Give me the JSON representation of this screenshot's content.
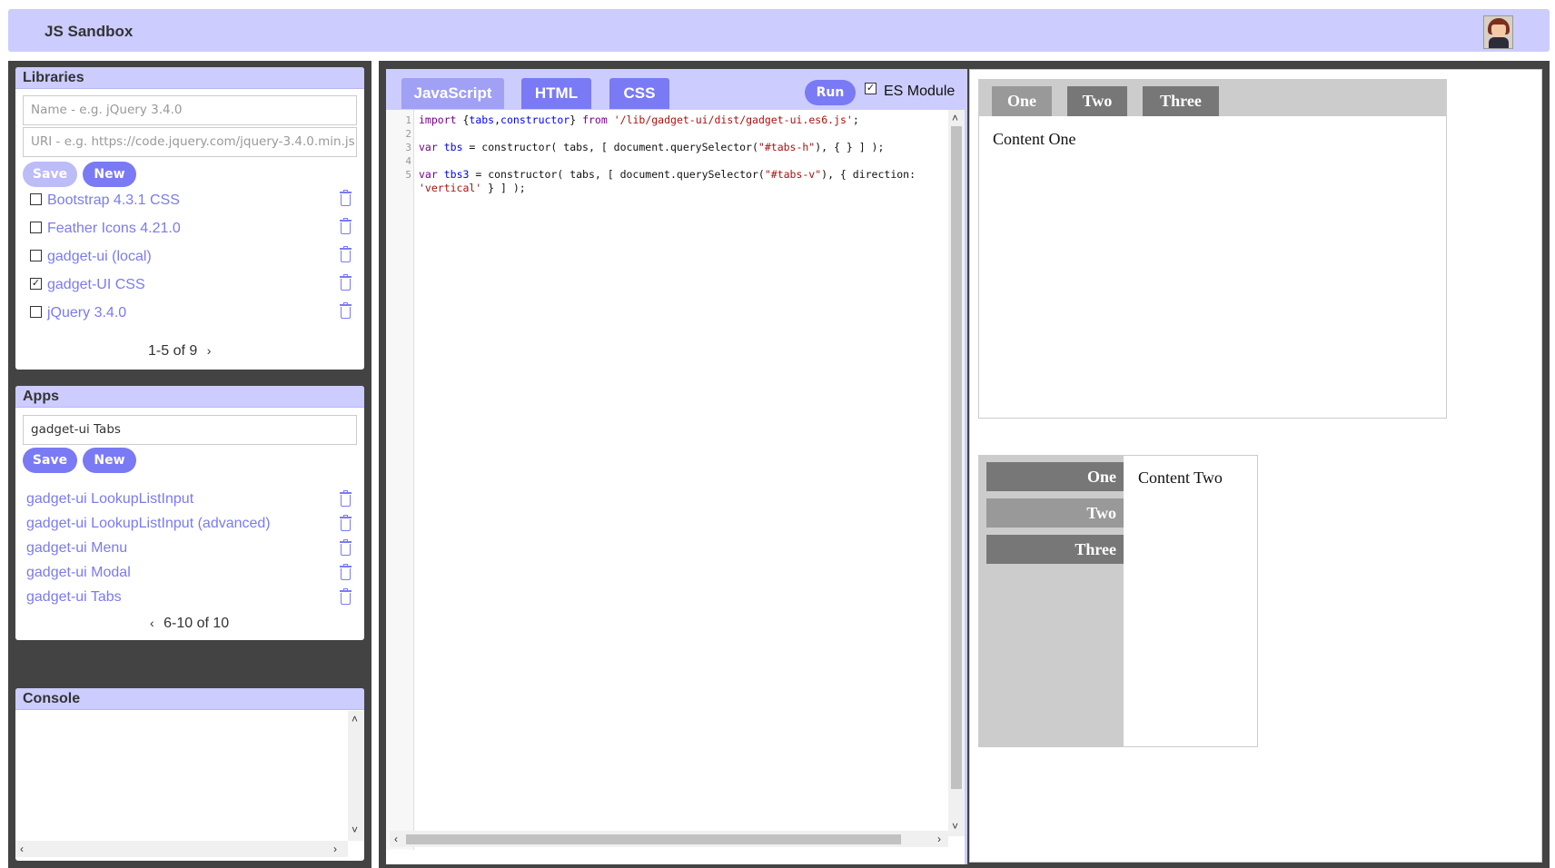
{
  "header": {
    "title": "JS Sandbox"
  },
  "libraries": {
    "title": "Libraries",
    "name_placeholder": "Name - e.g. jQuery 3.4.0",
    "uri_placeholder": "URI - e.g. https://code.jquery.com/jquery-3.4.0.min.js",
    "save_label": "Save",
    "new_label": "New",
    "items": [
      {
        "label": "Bootstrap 4.3.1 CSS",
        "checked": ""
      },
      {
        "label": "Feather Icons 4.21.0",
        "checked": ""
      },
      {
        "label": "gadget-ui (local)",
        "checked": ""
      },
      {
        "label": "gadget-UI CSS",
        "checked": "✓"
      },
      {
        "label": "jQuery 3.4.0",
        "checked": ""
      }
    ],
    "pagination": "1-5 of 9"
  },
  "apps": {
    "title": "Apps",
    "name_value": "gadget-ui Tabs",
    "save_label": "Save",
    "new_label": "New",
    "items": [
      {
        "label": "gadget-ui LookupListInput"
      },
      {
        "label": "gadget-ui LookupListInput (advanced)"
      },
      {
        "label": "gadget-ui Menu"
      },
      {
        "label": "gadget-ui Modal"
      },
      {
        "label": "gadget-ui Tabs"
      }
    ],
    "pagination": "6-10 of 10"
  },
  "console": {
    "title": "Console"
  },
  "editor": {
    "tabs": [
      {
        "label": "JavaScript"
      },
      {
        "label": "HTML"
      },
      {
        "label": "CSS"
      }
    ],
    "active_tab": "JavaScript",
    "run_label": "Run",
    "es_module_label": "ES Module",
    "es_module_checked": "✓",
    "line_numbers": [
      "1",
      "2",
      "3",
      "4",
      "5"
    ],
    "code": [
      {
        "kw1": "import",
        "p1": " {",
        "v1": "tabs",
        "p2": ",",
        "v2": "constructor",
        "p3": "} ",
        "kw2": "from",
        "p4": " ",
        "s1": "'/lib/gadget-ui/dist/gadget-ui.es6.js'",
        "p5": ";"
      },
      {
        "kw": "var",
        "p1": " ",
        "v": "tbs",
        "p2": " = constructor( tabs, [ document.querySelector(",
        "s": "\"#tabs-h\"",
        "p3": "), { } ] );"
      },
      {
        "kw": "var",
        "p1": " ",
        "v": "tbs3",
        "p2": " = constructor( tabs, [ document.querySelector(",
        "s1": "\"#tabs-v\"",
        "p3": "), { direction:",
        "s2": "'vertical'",
        "p4": " } ] );"
      }
    ]
  },
  "preview": {
    "horizontal_tabs": [
      {
        "label": "One"
      },
      {
        "label": "Two"
      },
      {
        "label": "Three"
      }
    ],
    "horizontal_content": "Content One",
    "vertical_tabs": [
      {
        "label": "One"
      },
      {
        "label": "Two"
      },
      {
        "label": "Three"
      }
    ],
    "vertical_content": "Content Two"
  }
}
